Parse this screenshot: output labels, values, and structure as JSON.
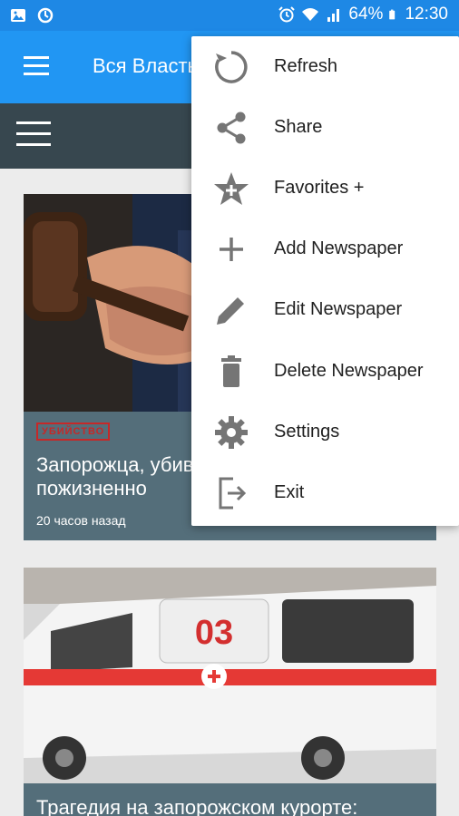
{
  "status_bar": {
    "battery": "64%",
    "time": "12:30"
  },
  "app_bar": {
    "title": "Вся Власть"
  },
  "articles": [
    {
      "tag": "УБИЙСТВО",
      "title": "Запорожца, убившего женщину, пожизненно",
      "time": "20 часов назад",
      "image_icon": "judge-gavel-image"
    },
    {
      "title": "Трагедия на запорожском курорте:",
      "image_icon": "ambulance-image",
      "image_text": "03"
    }
  ],
  "menu": {
    "items": [
      {
        "label": "Refresh",
        "icon": "refresh-icon"
      },
      {
        "label": "Share",
        "icon": "share-icon"
      },
      {
        "label": "Favorites +",
        "icon": "star-plus-icon"
      },
      {
        "label": "Add Newspaper",
        "icon": "plus-icon"
      },
      {
        "label": "Edit Newspaper",
        "icon": "pencil-icon"
      },
      {
        "label": "Delete Newspaper",
        "icon": "trash-icon"
      },
      {
        "label": "Settings",
        "icon": "gear-icon"
      },
      {
        "label": "Exit",
        "icon": "exit-icon"
      }
    ]
  },
  "colors": {
    "status_bar": "#1e88e5",
    "app_bar": "#2196f3",
    "sub_bar": "#37474f",
    "card_footer": "#546e7a",
    "icon_gray": "#757575"
  }
}
